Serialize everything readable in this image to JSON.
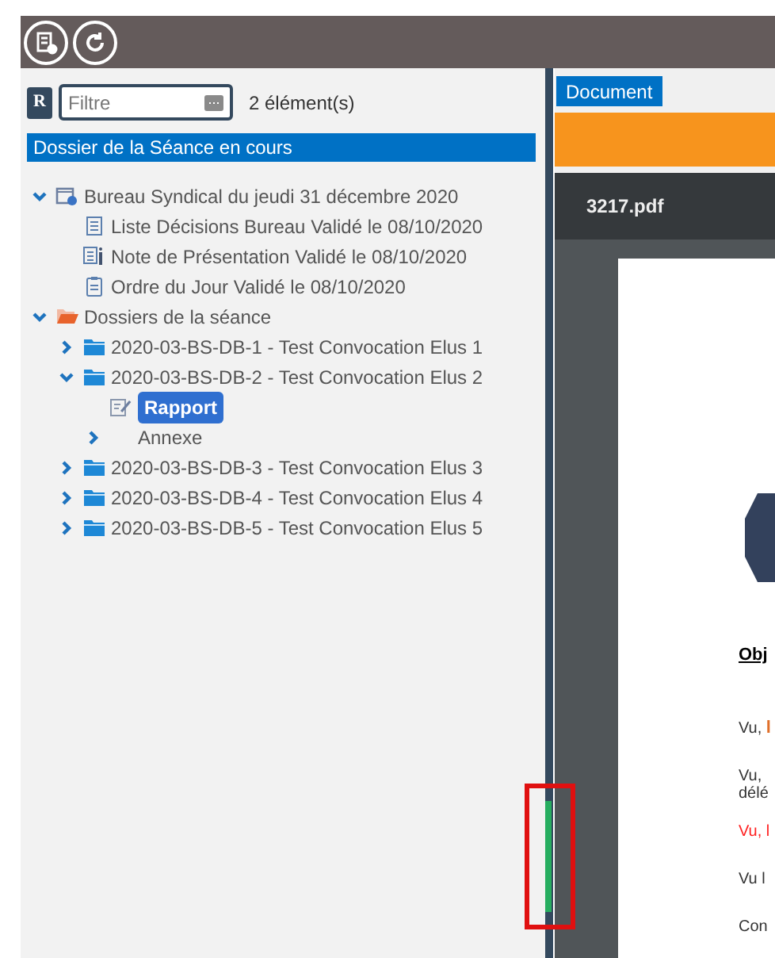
{
  "toolbar": {
    "buttons": [
      {
        "kind": "document"
      },
      {
        "kind": "refresh"
      }
    ]
  },
  "filter": {
    "badge": "R",
    "placeholder": "Filtre",
    "count": "2 élément(s)"
  },
  "section_title": "Dossier de la Séance en cours",
  "tree": [
    {
      "label": "Bureau Syndical du jeudi 31 décembre 2020",
      "kind": "calendar",
      "expanded": true,
      "selected": false,
      "children": [
        {
          "label": "Liste Décisions Bureau Validé le 08/10/2020",
          "kind": "list",
          "selected": false
        },
        {
          "label": "Note de Présentation Validé le 08/10/2020",
          "kind": "note",
          "selected": false
        },
        {
          "label": "Ordre du Jour Validé le 08/10/2020",
          "kind": "clipboard",
          "selected": false
        }
      ]
    },
    {
      "label": "Dossiers de la séance",
      "kind": "folder-open",
      "expanded": true,
      "selected": false,
      "children": [
        {
          "label": "2020-03-BS-DB-1 - Test Convocation Elus 1",
          "kind": "folder",
          "expanded": false,
          "selected": false
        },
        {
          "label": "2020-03-BS-DB-2 - Test Convocation Elus 2",
          "kind": "folder",
          "expanded": true,
          "selected": false,
          "children": [
            {
              "label": "Rapport",
              "kind": "edit",
              "selected": true
            },
            {
              "label": "Annexe",
              "kind": "plain",
              "expanded": false,
              "selected": false
            }
          ]
        },
        {
          "label": "2020-03-BS-DB-3 - Test Convocation Elus 3",
          "kind": "folder",
          "expanded": false,
          "selected": false
        },
        {
          "label": "2020-03-BS-DB-4 - Test Convocation Elus 4",
          "kind": "folder",
          "expanded": false,
          "selected": false
        },
        {
          "label": "2020-03-BS-DB-5 - Test Convocation Elus 5",
          "kind": "folder",
          "expanded": false,
          "selected": false
        }
      ]
    }
  ],
  "document": {
    "tab": "Document",
    "file_name": "3217.pdf",
    "lines": [
      {
        "kind": "heading",
        "parts": [
          {
            "text": "Obj",
            "color": "#000000"
          }
        ]
      },
      {
        "kind": "text",
        "parts": [
          {
            "text": "Vu, ",
            "color": "#333333"
          },
          {
            "text": "l",
            "color": "#e0702a"
          }
        ]
      },
      {
        "kind": "wrap",
        "parts": [
          {
            "text": "Vu,",
            "color": "#333333"
          }
        ]
      },
      {
        "kind": "cont",
        "parts": [
          {
            "text": "délé",
            "color": "#333333"
          }
        ]
      },
      {
        "kind": "text",
        "parts": [
          {
            "text": "Vu, l",
            "color": "#ff2020"
          }
        ]
      },
      {
        "kind": "text",
        "parts": [
          {
            "text": "Vu l",
            "color": "#333333"
          }
        ]
      },
      {
        "kind": "text",
        "parts": [
          {
            "text": "Con",
            "color": "#333333"
          }
        ]
      }
    ]
  }
}
